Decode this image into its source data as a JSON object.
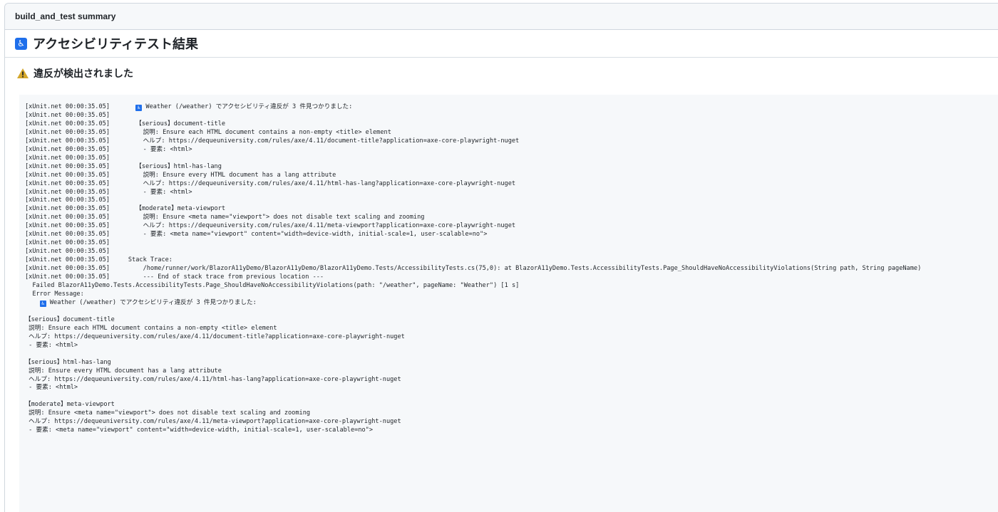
{
  "summary_title": "build_and_test summary",
  "heading": {
    "icon": "accessibility-icon",
    "glyph": "♿",
    "text": "アクセシビリティテスト結果"
  },
  "subheading": {
    "icon": "warning-icon",
    "text": "違反が検出されました"
  },
  "log_lines": [
    {
      "pre": "[xUnit.net 00:00:35.05]       ",
      "icon": true,
      "text": " Weather (/weather) でアクセシビリティ違反が 3 件見つかりました:"
    },
    {
      "pre": "[xUnit.net 00:00:35.05]",
      "text": ""
    },
    {
      "pre": "[xUnit.net 00:00:35.05]       ",
      "text": "【serious】document-title"
    },
    {
      "pre": "[xUnit.net 00:00:35.05]       ",
      "text": "  説明: Ensure each HTML document contains a non-empty <title> element"
    },
    {
      "pre": "[xUnit.net 00:00:35.05]       ",
      "text": "  ヘルプ: https://dequeuniversity.com/rules/axe/4.11/document-title?application=axe-core-playwright-nuget"
    },
    {
      "pre": "[xUnit.net 00:00:35.05]       ",
      "text": "  - 要素: <html>"
    },
    {
      "pre": "[xUnit.net 00:00:35.05]",
      "text": ""
    },
    {
      "pre": "[xUnit.net 00:00:35.05]       ",
      "text": "【serious】html-has-lang"
    },
    {
      "pre": "[xUnit.net 00:00:35.05]       ",
      "text": "  説明: Ensure every HTML document has a lang attribute"
    },
    {
      "pre": "[xUnit.net 00:00:35.05]       ",
      "text": "  ヘルプ: https://dequeuniversity.com/rules/axe/4.11/html-has-lang?application=axe-core-playwright-nuget"
    },
    {
      "pre": "[xUnit.net 00:00:35.05]       ",
      "text": "  - 要素: <html>"
    },
    {
      "pre": "[xUnit.net 00:00:35.05]",
      "text": ""
    },
    {
      "pre": "[xUnit.net 00:00:35.05]       ",
      "text": "【moderate】meta-viewport"
    },
    {
      "pre": "[xUnit.net 00:00:35.05]       ",
      "text": "  説明: Ensure <meta name=\"viewport\"> does not disable text scaling and zooming"
    },
    {
      "pre": "[xUnit.net 00:00:35.05]       ",
      "text": "  ヘルプ: https://dequeuniversity.com/rules/axe/4.11/meta-viewport?application=axe-core-playwright-nuget"
    },
    {
      "pre": "[xUnit.net 00:00:35.05]       ",
      "text": "  - 要素: <meta name=\"viewport\" content=\"width=device-width, initial-scale=1, user-scalable=no\">"
    },
    {
      "pre": "[xUnit.net 00:00:35.05]",
      "text": ""
    },
    {
      "pre": "[xUnit.net 00:00:35.05]",
      "text": ""
    },
    {
      "pre": "[xUnit.net 00:00:35.05]     ",
      "text": "Stack Trace:"
    },
    {
      "pre": "[xUnit.net 00:00:35.05]       ",
      "text": "  /home/runner/work/BlazorA11yDemo/BlazorA11yDemo/BlazorA11yDemo.Tests/AccessibilityTests.cs(75,0): at BlazorA11yDemo.Tests.AccessibilityTests.Page_ShouldHaveNoAccessibilityViolations(String path, String pageName)"
    },
    {
      "pre": "[xUnit.net 00:00:35.05]       ",
      "text": "  --- End of stack trace from previous location ---"
    },
    {
      "pre": "",
      "text": "  Failed BlazorA11yDemo.Tests.AccessibilityTests.Page_ShouldHaveNoAccessibilityViolations(path: \"/weather\", pageName: \"Weather\") [1 s]"
    },
    {
      "pre": "",
      "text": "  Error Message:"
    },
    {
      "pre": "    ",
      "icon": true,
      "text": " Weather (/weather) でアクセシビリティ違反が 3 件見つかりました:"
    },
    {
      "pre": "",
      "text": ""
    },
    {
      "pre": "",
      "text": "【serious】document-title"
    },
    {
      "pre": "",
      "text": " 説明: Ensure each HTML document contains a non-empty <title> element"
    },
    {
      "pre": "",
      "text": " ヘルプ: https://dequeuniversity.com/rules/axe/4.11/document-title?application=axe-core-playwright-nuget"
    },
    {
      "pre": "",
      "text": " - 要素: <html>"
    },
    {
      "pre": "",
      "text": ""
    },
    {
      "pre": "",
      "text": "【serious】html-has-lang"
    },
    {
      "pre": "",
      "text": " 説明: Ensure every HTML document has a lang attribute"
    },
    {
      "pre": "",
      "text": " ヘルプ: https://dequeuniversity.com/rules/axe/4.11/html-has-lang?application=axe-core-playwright-nuget"
    },
    {
      "pre": "",
      "text": " - 要素: <html>"
    },
    {
      "pre": "",
      "text": ""
    },
    {
      "pre": "",
      "text": "【moderate】meta-viewport"
    },
    {
      "pre": "",
      "text": " 説明: Ensure <meta name=\"viewport\"> does not disable text scaling and zooming"
    },
    {
      "pre": "",
      "text": " ヘルプ: https://dequeuniversity.com/rules/axe/4.11/meta-viewport?application=axe-core-playwright-nuget"
    },
    {
      "pre": "",
      "text": " - 要素: <meta name=\"viewport\" content=\"width=device-width, initial-scale=1, user-scalable=no\">"
    }
  ],
  "colors": {
    "accent": "#1f6feb",
    "warning": "#d4a72c",
    "code_bg": "#f6f8fa",
    "border": "#d0d7de"
  }
}
